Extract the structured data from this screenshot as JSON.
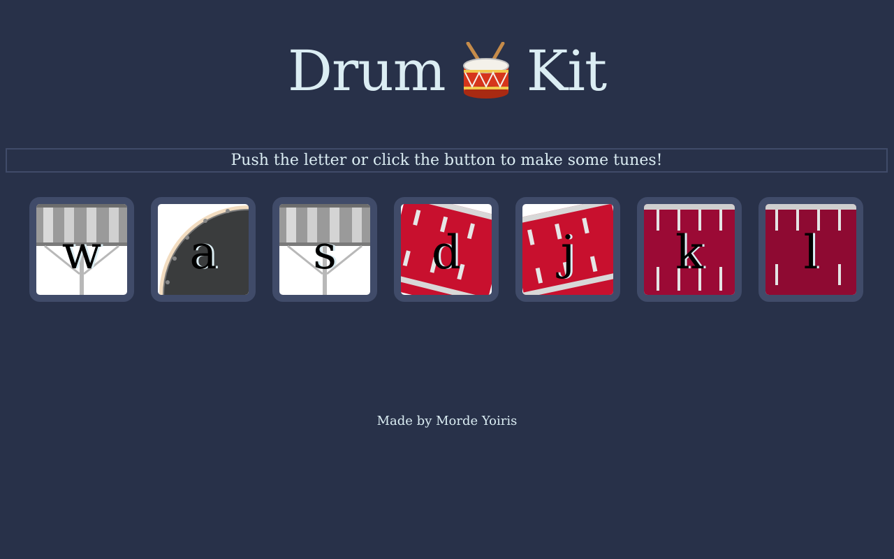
{
  "header": {
    "title_left": "Drum",
    "title_right": "Kit",
    "emoji_icon": "drum-with-drumsticks-icon"
  },
  "instructions": "Push the letter or click the button to make some tunes!",
  "drums": [
    {
      "key": "w",
      "style": "silver-tom",
      "icon": "tom-drum-icon"
    },
    {
      "key": "a",
      "style": "bass-black",
      "icon": "bass-drum-icon"
    },
    {
      "key": "s",
      "style": "silver-tom",
      "icon": "tom-drum-icon"
    },
    {
      "key": "d",
      "style": "red-tilted",
      "icon": "red-drum-icon"
    },
    {
      "key": "j",
      "style": "red-tilted",
      "icon": "red-drum-icon"
    },
    {
      "key": "k",
      "style": "crimson-upright",
      "icon": "crimson-drum-icon"
    },
    {
      "key": "l",
      "style": "crimson-upright",
      "icon": "crimson-drum-icon"
    }
  ],
  "footer": "Made by Morde Yoiris",
  "colors": {
    "background": "#283149",
    "text": "#dbedf3",
    "border": "#404b69",
    "drum_red": "#c8102e",
    "drum_crimson": "#9b0a35",
    "drum_silver": "#a8a8a8"
  }
}
